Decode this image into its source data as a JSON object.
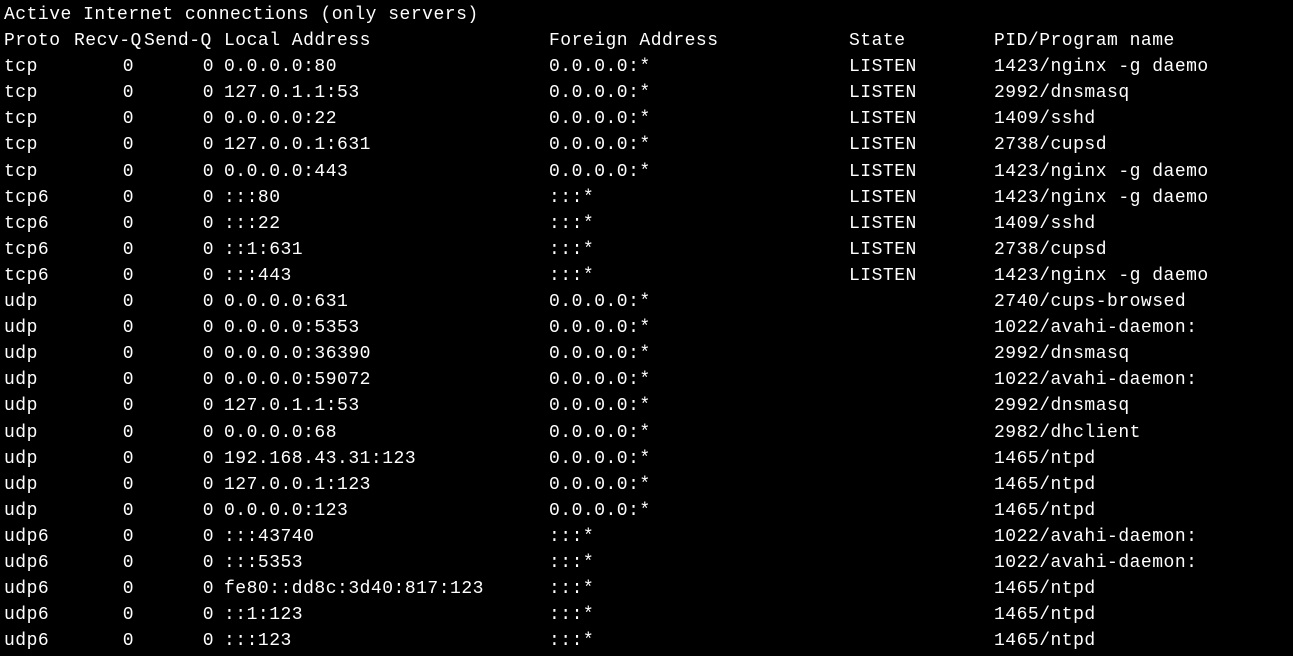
{
  "title": "Active Internet connections (only servers)",
  "headers": {
    "proto": "Proto",
    "recvq": "Recv-Q",
    "sendq": "Send-Q",
    "local": "Local Address",
    "foreign": "Foreign Address",
    "state": "State",
    "prog": "PID/Program name"
  },
  "rows": [
    {
      "proto": "tcp",
      "recvq": "0",
      "sendq": "0",
      "local": "0.0.0.0:80",
      "foreign": "0.0.0.0:*",
      "state": "LISTEN",
      "prog": "1423/nginx -g daemo"
    },
    {
      "proto": "tcp",
      "recvq": "0",
      "sendq": "0",
      "local": "127.0.1.1:53",
      "foreign": "0.0.0.0:*",
      "state": "LISTEN",
      "prog": "2992/dnsmasq"
    },
    {
      "proto": "tcp",
      "recvq": "0",
      "sendq": "0",
      "local": "0.0.0.0:22",
      "foreign": "0.0.0.0:*",
      "state": "LISTEN",
      "prog": "1409/sshd"
    },
    {
      "proto": "tcp",
      "recvq": "0",
      "sendq": "0",
      "local": "127.0.0.1:631",
      "foreign": "0.0.0.0:*",
      "state": "LISTEN",
      "prog": "2738/cupsd"
    },
    {
      "proto": "tcp",
      "recvq": "0",
      "sendq": "0",
      "local": "0.0.0.0:443",
      "foreign": "0.0.0.0:*",
      "state": "LISTEN",
      "prog": "1423/nginx -g daemo"
    },
    {
      "proto": "tcp6",
      "recvq": "0",
      "sendq": "0",
      "local": ":::80",
      "foreign": ":::*",
      "state": "LISTEN",
      "prog": "1423/nginx -g daemo"
    },
    {
      "proto": "tcp6",
      "recvq": "0",
      "sendq": "0",
      "local": ":::22",
      "foreign": ":::*",
      "state": "LISTEN",
      "prog": "1409/sshd"
    },
    {
      "proto": "tcp6",
      "recvq": "0",
      "sendq": "0",
      "local": "::1:631",
      "foreign": ":::*",
      "state": "LISTEN",
      "prog": "2738/cupsd"
    },
    {
      "proto": "tcp6",
      "recvq": "0",
      "sendq": "0",
      "local": ":::443",
      "foreign": ":::*",
      "state": "LISTEN",
      "prog": "1423/nginx -g daemo"
    },
    {
      "proto": "udp",
      "recvq": "0",
      "sendq": "0",
      "local": "0.0.0.0:631",
      "foreign": "0.0.0.0:*",
      "state": "",
      "prog": "2740/cups-browsed"
    },
    {
      "proto": "udp",
      "recvq": "0",
      "sendq": "0",
      "local": "0.0.0.0:5353",
      "foreign": "0.0.0.0:*",
      "state": "",
      "prog": "1022/avahi-daemon:"
    },
    {
      "proto": "udp",
      "recvq": "0",
      "sendq": "0",
      "local": "0.0.0.0:36390",
      "foreign": "0.0.0.0:*",
      "state": "",
      "prog": "2992/dnsmasq"
    },
    {
      "proto": "udp",
      "recvq": "0",
      "sendq": "0",
      "local": "0.0.0.0:59072",
      "foreign": "0.0.0.0:*",
      "state": "",
      "prog": "1022/avahi-daemon:"
    },
    {
      "proto": "udp",
      "recvq": "0",
      "sendq": "0",
      "local": "127.0.1.1:53",
      "foreign": "0.0.0.0:*",
      "state": "",
      "prog": "2992/dnsmasq"
    },
    {
      "proto": "udp",
      "recvq": "0",
      "sendq": "0",
      "local": "0.0.0.0:68",
      "foreign": "0.0.0.0:*",
      "state": "",
      "prog": "2982/dhclient"
    },
    {
      "proto": "udp",
      "recvq": "0",
      "sendq": "0",
      "local": "192.168.43.31:123",
      "foreign": "0.0.0.0:*",
      "state": "",
      "prog": "1465/ntpd"
    },
    {
      "proto": "udp",
      "recvq": "0",
      "sendq": "0",
      "local": "127.0.0.1:123",
      "foreign": "0.0.0.0:*",
      "state": "",
      "prog": "1465/ntpd"
    },
    {
      "proto": "udp",
      "recvq": "0",
      "sendq": "0",
      "local": "0.0.0.0:123",
      "foreign": "0.0.0.0:*",
      "state": "",
      "prog": "1465/ntpd"
    },
    {
      "proto": "udp6",
      "recvq": "0",
      "sendq": "0",
      "local": ":::43740",
      "foreign": ":::*",
      "state": "",
      "prog": "1022/avahi-daemon:"
    },
    {
      "proto": "udp6",
      "recvq": "0",
      "sendq": "0",
      "local": ":::5353",
      "foreign": ":::*",
      "state": "",
      "prog": "1022/avahi-daemon:"
    },
    {
      "proto": "udp6",
      "recvq": "0",
      "sendq": "0",
      "local": "fe80::dd8c:3d40:817:123",
      "foreign": ":::*",
      "state": "",
      "prog": "1465/ntpd"
    },
    {
      "proto": "udp6",
      "recvq": "0",
      "sendq": "0",
      "local": "::1:123",
      "foreign": ":::*",
      "state": "",
      "prog": "1465/ntpd"
    },
    {
      "proto": "udp6",
      "recvq": "0",
      "sendq": "0",
      "local": ":::123",
      "foreign": ":::*",
      "state": "",
      "prog": "1465/ntpd"
    }
  ]
}
